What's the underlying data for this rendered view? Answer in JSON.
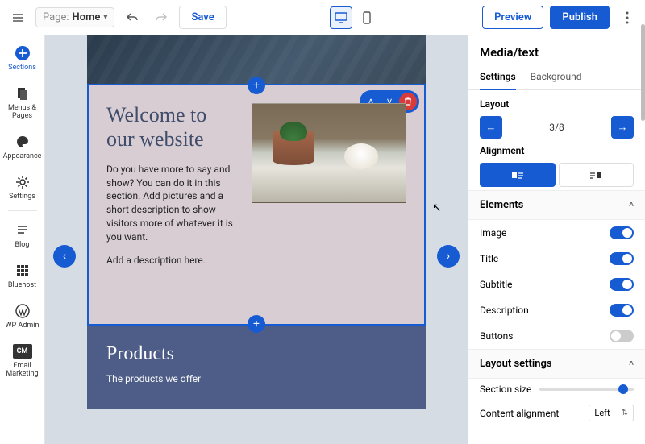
{
  "topbar": {
    "page_label": "Page:",
    "page_value": "Home",
    "save": "Save",
    "preview": "Preview",
    "publish": "Publish"
  },
  "sidebar": {
    "items": [
      {
        "label": "Sections"
      },
      {
        "label": "Menus & Pages"
      },
      {
        "label": "Appearance"
      },
      {
        "label": "Settings"
      },
      {
        "label": "Blog"
      },
      {
        "label": "Bluehost"
      },
      {
        "label": "WP Admin"
      },
      {
        "label": "Email Marketing"
      }
    ]
  },
  "canvas": {
    "welcome": {
      "title": "Welcome to our website",
      "para1": "Do you have more to say and show? You can do it in this section. Add pictures and a short description to show visitors more of whatever it is you want.",
      "para2": "Add a description here."
    },
    "products": {
      "title": "Products",
      "subtitle": "The products we offer"
    }
  },
  "panel": {
    "title": "Media/text",
    "tabs": {
      "settings": "Settings",
      "background": "Background"
    },
    "layout": {
      "heading": "Layout",
      "value": "3/8",
      "alignment_heading": "Alignment"
    },
    "elements": {
      "heading": "Elements",
      "rows": [
        {
          "label": "Image",
          "on": true
        },
        {
          "label": "Title",
          "on": true
        },
        {
          "label": "Subtitle",
          "on": true
        },
        {
          "label": "Description",
          "on": true
        },
        {
          "label": "Buttons",
          "on": false
        }
      ]
    },
    "layout_settings": {
      "heading": "Layout settings",
      "section_size": "Section size",
      "content_alignment_label": "Content alignment",
      "content_alignment_value": "Left"
    }
  }
}
